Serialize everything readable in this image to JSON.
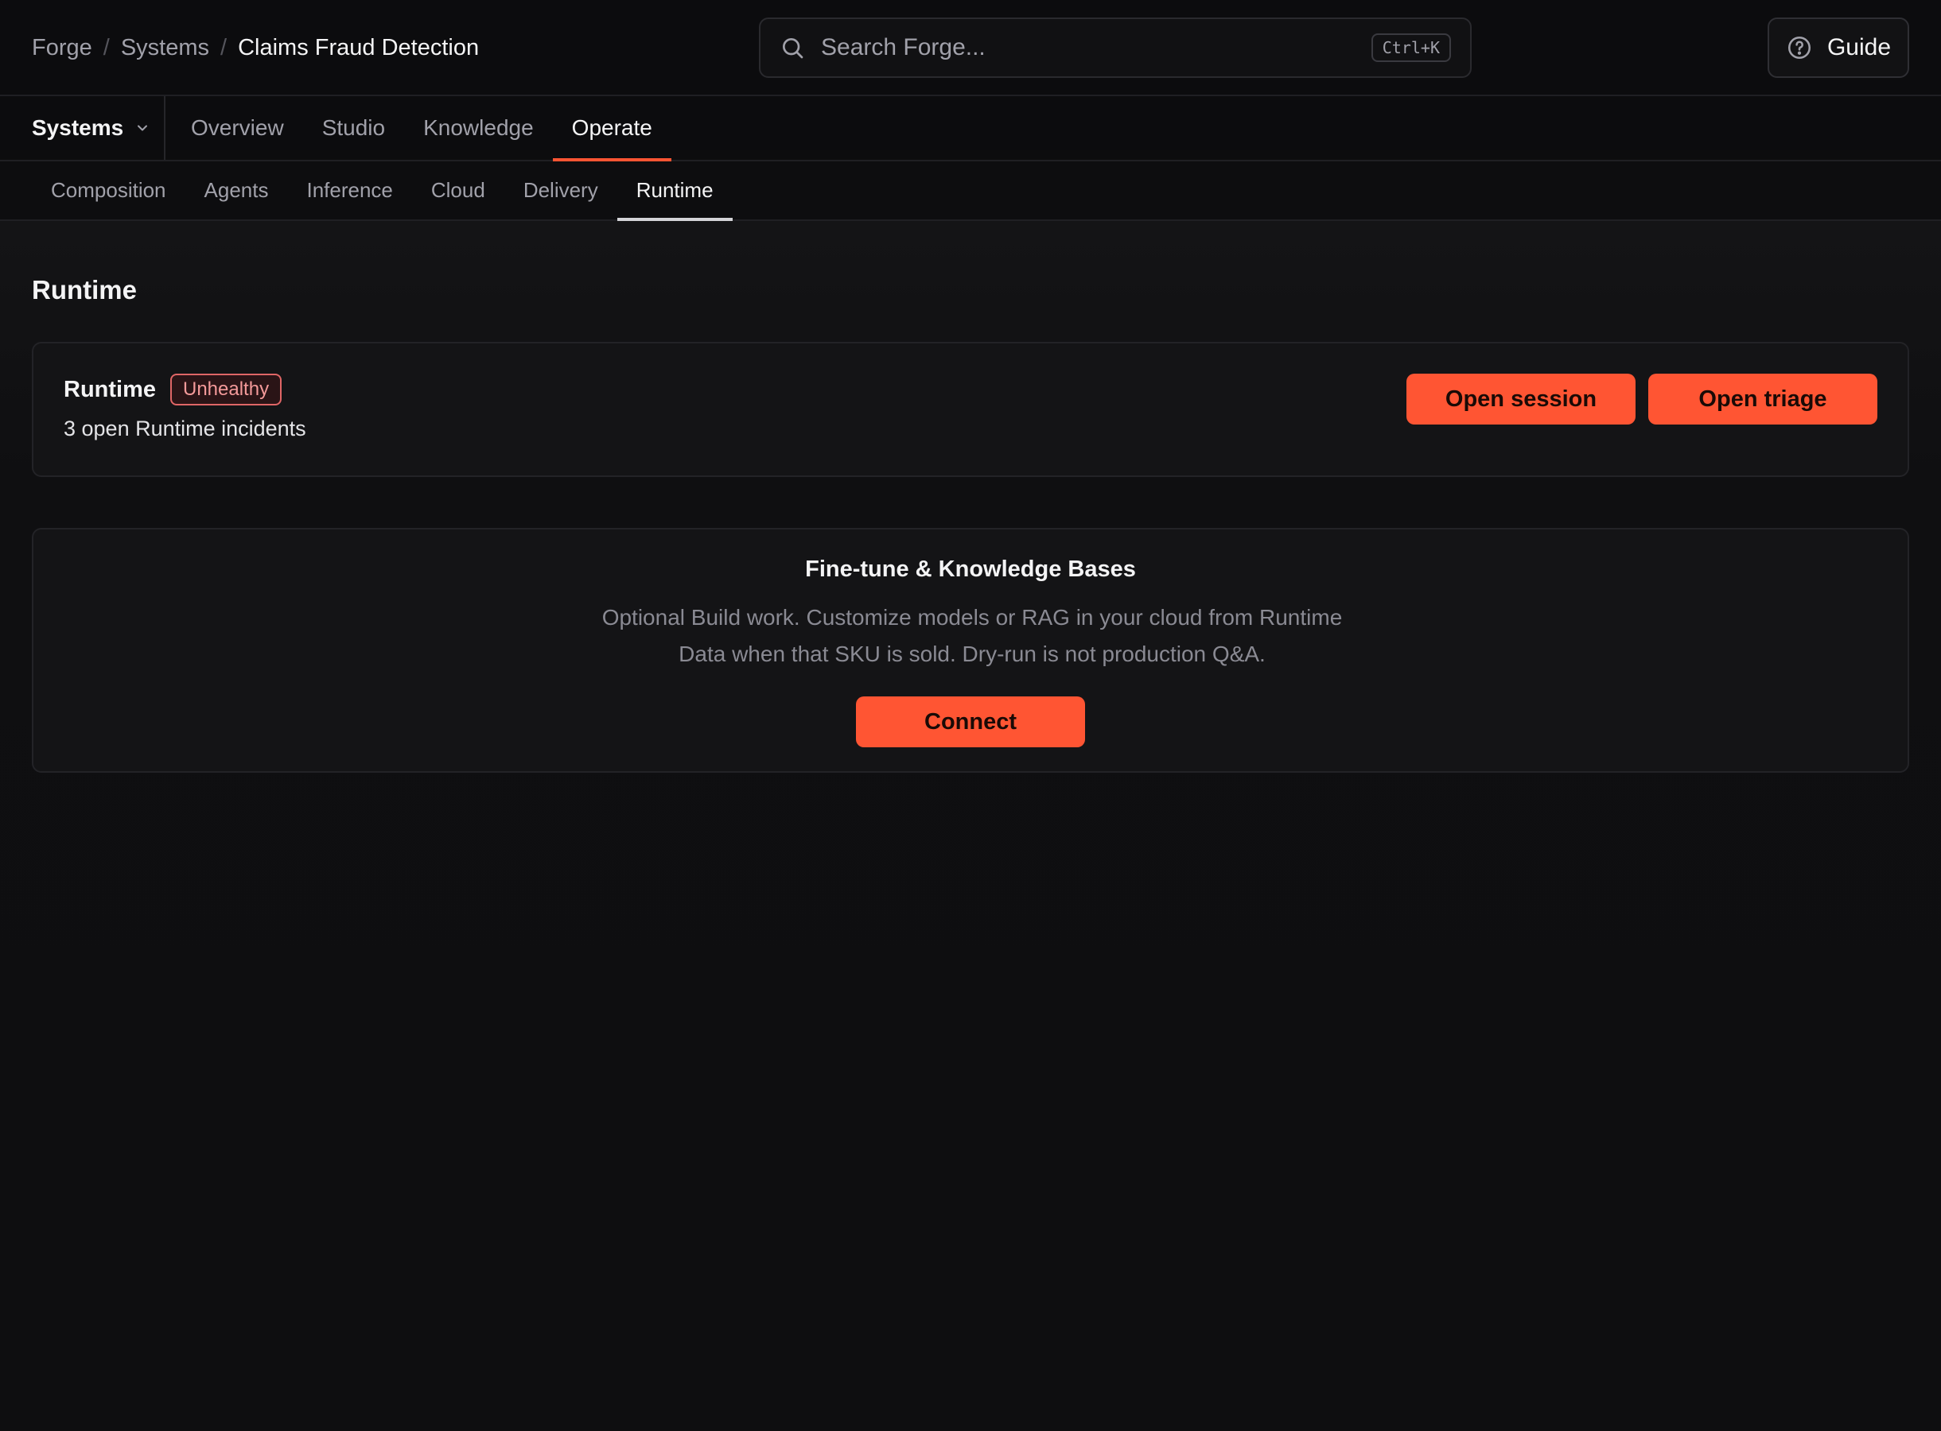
{
  "breadcrumb": {
    "items": [
      "Forge",
      "Systems",
      "Claims Fraud Detection"
    ],
    "separator": "/"
  },
  "search": {
    "placeholder": "Search Forge...",
    "shortcut": "Ctrl+K"
  },
  "guide": {
    "label": "Guide"
  },
  "systems_selector": {
    "label": "Systems"
  },
  "tabs": [
    {
      "label": "Overview",
      "active": false
    },
    {
      "label": "Studio",
      "active": false
    },
    {
      "label": "Knowledge",
      "active": false
    },
    {
      "label": "Operate",
      "active": true
    }
  ],
  "subtabs": [
    {
      "label": "Composition",
      "active": false
    },
    {
      "label": "Agents",
      "active": false
    },
    {
      "label": "Inference",
      "active": false
    },
    {
      "label": "Cloud",
      "active": false
    },
    {
      "label": "Delivery",
      "active": false
    },
    {
      "label": "Runtime",
      "active": true
    }
  ],
  "page": {
    "title": "Runtime"
  },
  "runtime_card": {
    "title": "Runtime",
    "status": "Unhealthy",
    "summary": "3 open Runtime incidents",
    "open_session_label": "Open session",
    "open_triage_label": "Open triage"
  },
  "finetune_card": {
    "title": "Fine-tune & Knowledge Bases",
    "description_line1": "Optional Build work. Customize models or RAG in your cloud from Runtime",
    "description_line2": "Data when that SKU is sold. Dry-run is not production Q&A.",
    "connect_label": "Connect"
  },
  "colors": {
    "accent": "#ff5533",
    "background": "#0e0e10",
    "danger": "#f87171"
  }
}
